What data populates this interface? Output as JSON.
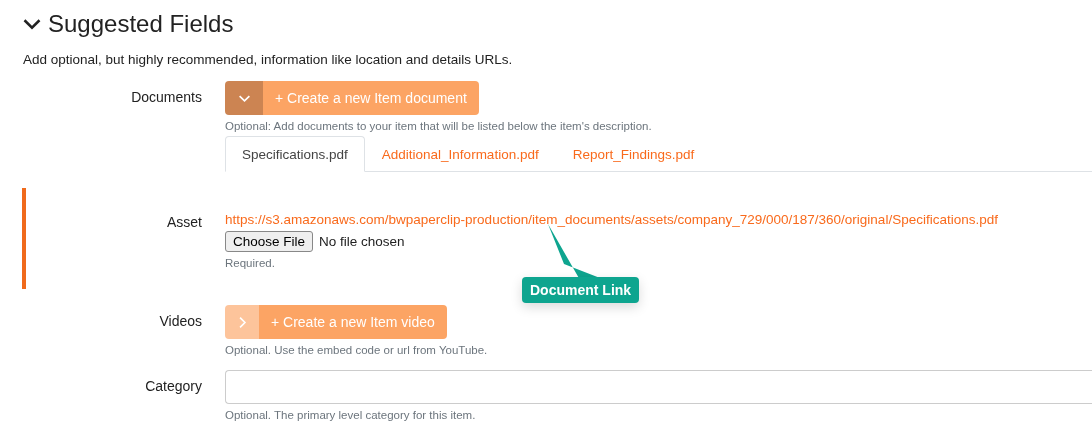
{
  "section": {
    "title": "Suggested Fields",
    "expanded": true,
    "description": "Add optional, but highly recommended, information like location and details URLs."
  },
  "documents": {
    "label": "Documents",
    "expanded": true,
    "create_button": "+ Create a new Item document",
    "help": "Optional: Add documents to your item that will be listed below the item's description.",
    "tabs": [
      {
        "label": "Specifications.pdf",
        "selected": true
      },
      {
        "label": "Additional_Information.pdf",
        "selected": false
      },
      {
        "label": "Report_Findings.pdf",
        "selected": false
      }
    ],
    "asset": {
      "label": "Asset",
      "link": "https://s3.amazonaws.com/bwpaperclip-production/item_documents/assets/company_729/000/187/360/original/Specifications.pdf",
      "file_button": "Choose File",
      "file_status": "No file chosen",
      "help": "Required."
    }
  },
  "callout": {
    "text": "Document Link"
  },
  "videos": {
    "label": "Videos",
    "expanded": false,
    "create_button": "+ Create a new Item video",
    "help": "Optional. Use the embed code or url from YouTube."
  },
  "category": {
    "label": "Category",
    "help": "Optional. The primary level category for this item."
  }
}
